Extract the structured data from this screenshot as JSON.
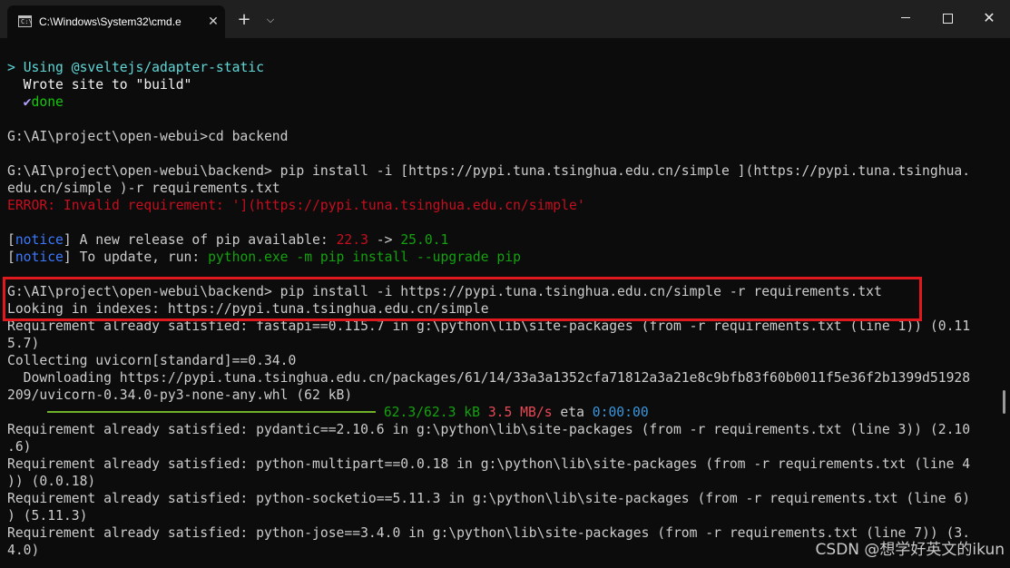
{
  "window": {
    "tab_title": "C:\\Windows\\System32\\cmd.e",
    "tab_icon": "C:\\",
    "tab_close": "✕",
    "new_tab": "+",
    "tab_menu": "⌵",
    "minimize_icon": "minimize-icon",
    "maximize_icon": "maximize-icon",
    "close": "✕"
  },
  "terminal": {
    "l01_prompt": "> ",
    "l01_text": "Using ",
    "l01_pkg": "@sveltejs/adapter-static",
    "l02": "  Wrote site to \"build\"",
    "l03_check": "  ✔",
    "l03_done": "done",
    "l04": "",
    "l05": "G:\\AI\\project\\open-webui>cd backend",
    "l06": "",
    "l07": "G:\\AI\\project\\open-webui\\backend> pip install -i [https://pypi.tuna.tsinghua.edu.cn/simple ](https://pypi.tuna.tsinghua.",
    "l08": "edu.cn/simple )-r requirements.txt",
    "l09": "ERROR: Invalid requirement: '](https://pypi.tuna.tsinghua.edu.cn/simple'",
    "l10": "",
    "l11_open": "[",
    "l11_notice": "notice",
    "l11_mid": "] A new release of pip available: ",
    "l11_old": "22.3",
    "l11_arrow": " -> ",
    "l11_new": "25.0.1",
    "l12_open": "[",
    "l12_notice": "notice",
    "l12_mid": "] To update, run: ",
    "l12_cmd": "python.exe -m pip install --upgrade pip",
    "l13": "",
    "l14": "G:\\AI\\project\\open-webui\\backend> pip install -i https://pypi.tuna.tsinghua.edu.cn/simple -r requirements.txt",
    "l15": "Looking in indexes: https://pypi.tuna.tsinghua.edu.cn/simple",
    "l16": "Requirement already satisfied: fastapi==0.115.7 in g:\\python\\lib\\site-packages (from -r requirements.txt (line 1)) (0.11",
    "l17": "5.7)",
    "l18": "Collecting uvicorn[standard]==0.34.0",
    "l19": "  Downloading https://pypi.tuna.tsinghua.edu.cn/packages/61/14/33a3a1352cfa71812a3a21e8c9bfb83f60b0011f5e36f2b1399d51928",
    "l20": "209/uvicorn-0.34.0-py3-none-any.whl (62 kB)",
    "l21_size": "62.3/62.3 kB",
    "l21_speed": "3.5 MB/s",
    "l21_eta_label": "eta",
    "l21_eta": "0:00:00",
    "l22": "Requirement already satisfied: pydantic==2.10.6 in g:\\python\\lib\\site-packages (from -r requirements.txt (line 3)) (2.10",
    "l23": ".6)",
    "l24": "Requirement already satisfied: python-multipart==0.0.18 in g:\\python\\lib\\site-packages (from -r requirements.txt (line 4",
    "l25": ")) (0.0.18)",
    "l26": "Requirement already satisfied: python-socketio==5.11.3 in g:\\python\\lib\\site-packages (from -r requirements.txt (line 6)",
    "l27": ") (5.11.3)",
    "l28": "Requirement already satisfied: python-jose==3.4.0 in g:\\python\\lib\\site-packages (from -r requirements.txt (line 7)) (3.",
    "l29": "4.0)"
  },
  "download_progress": 1.0,
  "watermark": "CSDN @想学好英文的ikun",
  "colors": {
    "background": "#0c0c0c",
    "titlebar": "#202020",
    "highlight_border": "#e0191e",
    "progress": "#6fb22a"
  }
}
